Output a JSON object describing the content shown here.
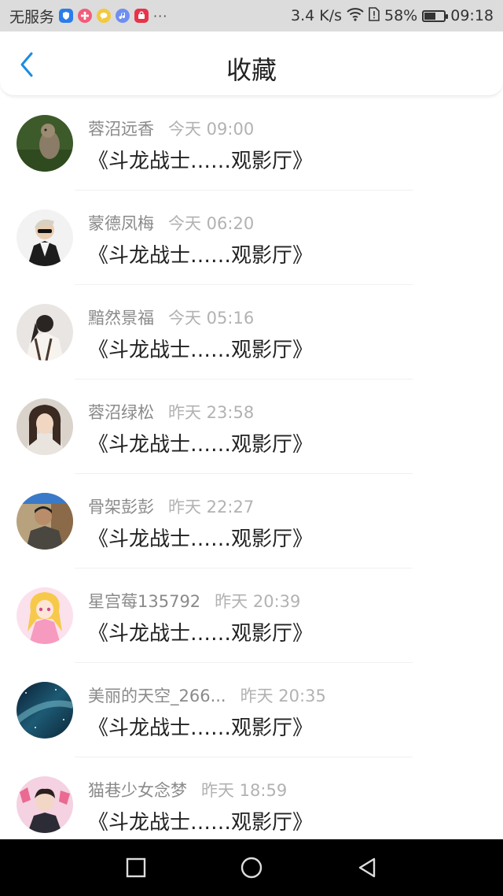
{
  "status_bar": {
    "carrier": "无服务",
    "network_speed": "3.4 K/s",
    "battery_percent": "58%",
    "battery_level": 0.58,
    "time": "09:18",
    "more_dots": "···",
    "notification_icons": [
      "shield-app-icon",
      "flower-app-icon",
      "chat-app-icon",
      "music-app-icon",
      "store-app-icon"
    ]
  },
  "header": {
    "title": "收藏",
    "back_icon": "chevron-left-icon"
  },
  "favorites": [
    {
      "name": "蓉沼远香",
      "time": "今天 09:00",
      "title": "《斗龙战士……观影厅》"
    },
    {
      "name": "蒙德凤梅",
      "time": "今天 06:20",
      "title": "《斗龙战士……观影厅》"
    },
    {
      "name": "黯然景福",
      "time": "今天 05:16",
      "title": "《斗龙战士……观影厅》"
    },
    {
      "name": "蓉沼绿松",
      "time": "昨天 23:58",
      "title": "《斗龙战士……观影厅》"
    },
    {
      "name": "骨架彭彭",
      "time": "昨天 22:27",
      "title": "《斗龙战士……观影厅》"
    },
    {
      "name": "星宫莓135792",
      "time": "昨天 20:39",
      "title": "《斗龙战士……观影厅》"
    },
    {
      "name": "美丽的天空_266...",
      "time": "昨天 20:35",
      "title": "《斗龙战士……观影厅》"
    },
    {
      "name": "猫巷少女念梦",
      "time": "昨天 18:59",
      "title": "《斗龙战士……观影厅》"
    }
  ],
  "nav_bar": {
    "buttons": [
      "recent-apps-icon",
      "home-icon",
      "back-triangle-icon"
    ]
  },
  "colors": {
    "accent": "#1a8ce0",
    "status_bar_bg": "#dcdcdc",
    "nav_bar_bg": "#000000",
    "meta_text": "#8a8a8a",
    "time_text": "#b2b2b2"
  }
}
